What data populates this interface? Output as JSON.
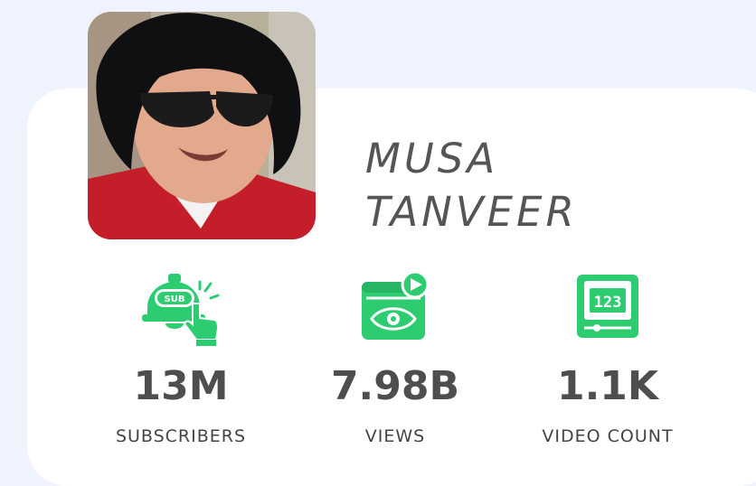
{
  "profile": {
    "name_line1": "MUSA",
    "name_line2": "TANVEER",
    "avatar_icon": "profile-photo"
  },
  "stats": [
    {
      "value": "13M",
      "label": "SUBSCRIBERS",
      "icon": "subscribe-bell-icon"
    },
    {
      "value": "7.98B",
      "label": "VIEWS",
      "icon": "video-eye-icon"
    },
    {
      "value": "1.1K",
      "label": "VIDEO COUNT",
      "icon": "counter-123-icon",
      "icon_text": "123"
    }
  ],
  "colors": {
    "background": "#eff3fd",
    "card": "#ffffff",
    "accent": "#2ecc71",
    "text": "#4e4e4e"
  }
}
